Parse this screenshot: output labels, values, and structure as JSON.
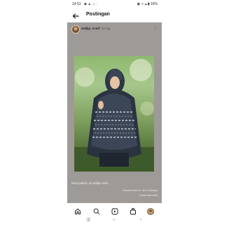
{
  "status_bar": {
    "time": "14.51",
    "signal_icons": "◆ ▲ ☼ ·",
    "right": "◉ ✧ ▴ ▮ 16%"
  },
  "header": {
    "title": "Postingan"
  },
  "post": {
    "username": "malija_scarf",
    "age": "20 mg",
    "caption_user": "",
    "caption_text": "New pattern of malija scarf...",
    "liked_by": "Disukai oleh m...lan & lainnya",
    "comments": "Lihat Komentar"
  },
  "icons": {
    "back": "arrow-left-icon",
    "more": "more-vertical-icon",
    "like": "heart-icon",
    "comment": "comment-icon",
    "share": "send-icon",
    "save": "bookmark-icon",
    "home": "home-icon",
    "search": "search-icon",
    "reels": "reels-icon",
    "shop": "shop-icon",
    "profile": "profile-avatar"
  },
  "system_nav": {
    "recents": "|||",
    "home": "○",
    "back": "‹"
  }
}
